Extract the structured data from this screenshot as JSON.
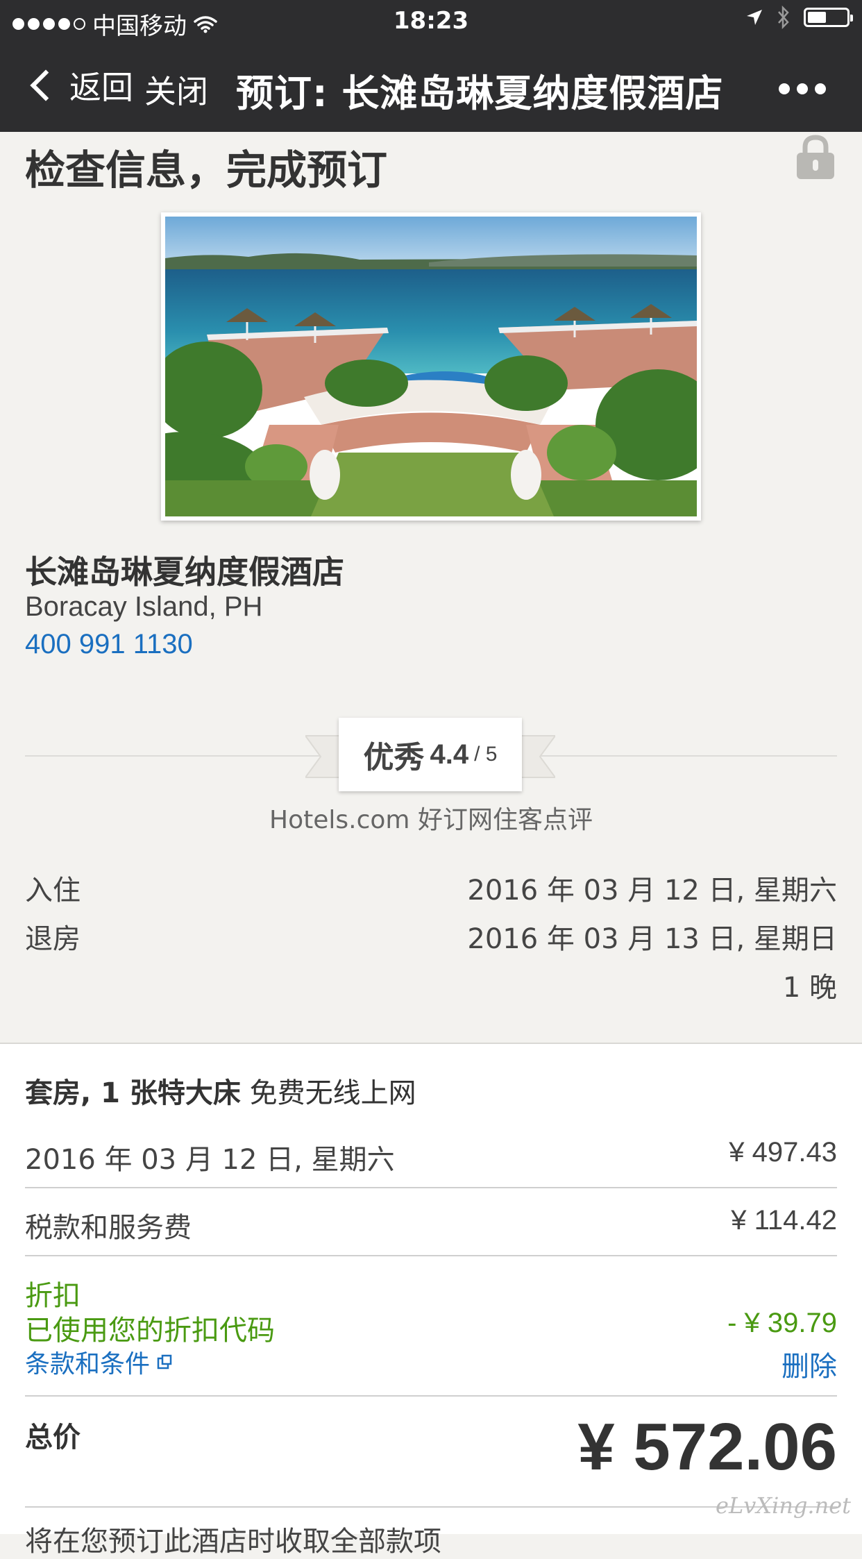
{
  "status_bar": {
    "carrier": "中国移动",
    "time": "18:23"
  },
  "nav": {
    "back_label": "返回",
    "close_label": "关闭",
    "title": "预订: 长滩岛琳夏纳度假酒店"
  },
  "header": {
    "heading": "检查信息，完成预订"
  },
  "hotel": {
    "name": "长滩岛琳夏纳度假酒店",
    "location": "Boracay Island, PH",
    "phone": "400 991 1130"
  },
  "rating": {
    "word": "优秀",
    "score": "4.4",
    "max": "/ 5",
    "source": "Hotels.com 好订网住客点评"
  },
  "stay": {
    "checkin_label": "入住",
    "checkin_value": "2016 年 03 月 12 日, 星期六",
    "checkout_label": "退房",
    "checkout_value": "2016 年 03 月 13 日, 星期日",
    "nights": "1 晚"
  },
  "price": {
    "room_type": "套房, 1 张特大床",
    "room_amenity": "免费无线上网",
    "night_date": "2016 年 03 月 12 日, 星期六",
    "night_price": "¥ 497.43",
    "tax_label": "税款和服务费",
    "tax_value": "¥ 114.42",
    "discount_label": "折扣",
    "discount_code_label": "已使用您的折扣代码",
    "terms_label": "条款和条件",
    "discount_value": "- ¥ 39.79",
    "delete_label": "删除",
    "total_label": "总价",
    "total_value": "¥ 572.06"
  },
  "footer": {
    "text": "将在您预订此酒店时收取全部款项"
  },
  "watermark": "eLvXing.net",
  "colors": {
    "bar_bg": "#2d2d2f",
    "link_blue": "#1a6fc0",
    "discount_green": "#4a9a12",
    "page_bg": "#f3f2ef"
  }
}
